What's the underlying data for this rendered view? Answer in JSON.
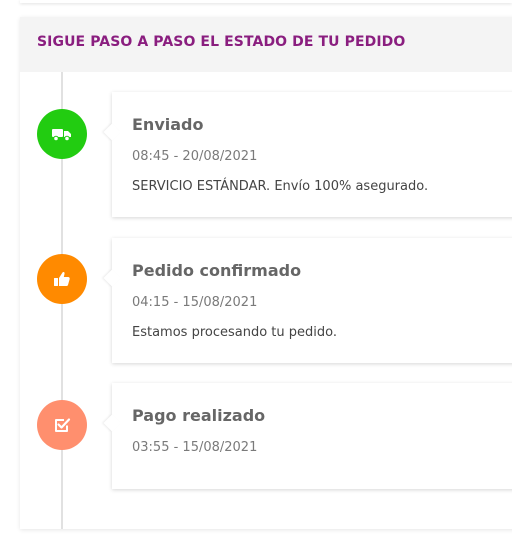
{
  "tracking": {
    "title": "SIGUE PASO A PASO EL ESTADO DE TU PEDIDO",
    "steps": [
      {
        "title": "Enviado",
        "date": "08:45 - 20/08/2021",
        "description": "SERVICIO ESTÁNDAR. Envío 100% asegurado.",
        "icon": "truck-icon",
        "color": "#22cc11"
      },
      {
        "title": "Pedido confirmado",
        "date": "04:15 - 15/08/2021",
        "description": "Estamos procesando tu pedido.",
        "icon": "thumbs-up-icon",
        "color": "#ff8a00"
      },
      {
        "title": "Pago realizado",
        "date": "03:55 - 15/08/2021",
        "description": "",
        "icon": "checkbox-icon",
        "color": "#ff8f6e"
      }
    ]
  }
}
